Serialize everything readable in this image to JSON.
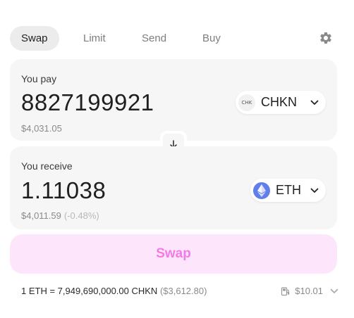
{
  "tabs": {
    "swap": "Swap",
    "limit": "Limit",
    "send": "Send",
    "buy": "Buy"
  },
  "pay": {
    "label": "You pay",
    "amount": "8827199921",
    "fiat": "$4,031.05",
    "token_symbol": "CHKN",
    "token_icon_text": "CHK"
  },
  "receive": {
    "label": "You receive",
    "amount": "1.11038",
    "fiat": "$4,011.59",
    "fiat_delta": "(-0.48%)",
    "token_symbol": "ETH"
  },
  "swap_button_label": "Swap",
  "footer": {
    "rate": "1 ETH = 7,949,690,000.00 CHKN",
    "rate_fiat": "($3,612.80)",
    "gas_fee": "$10.01"
  },
  "colors": {
    "accent": "#f37ae8",
    "accent_bg": "#fde6fb",
    "eth": "#627eea"
  }
}
